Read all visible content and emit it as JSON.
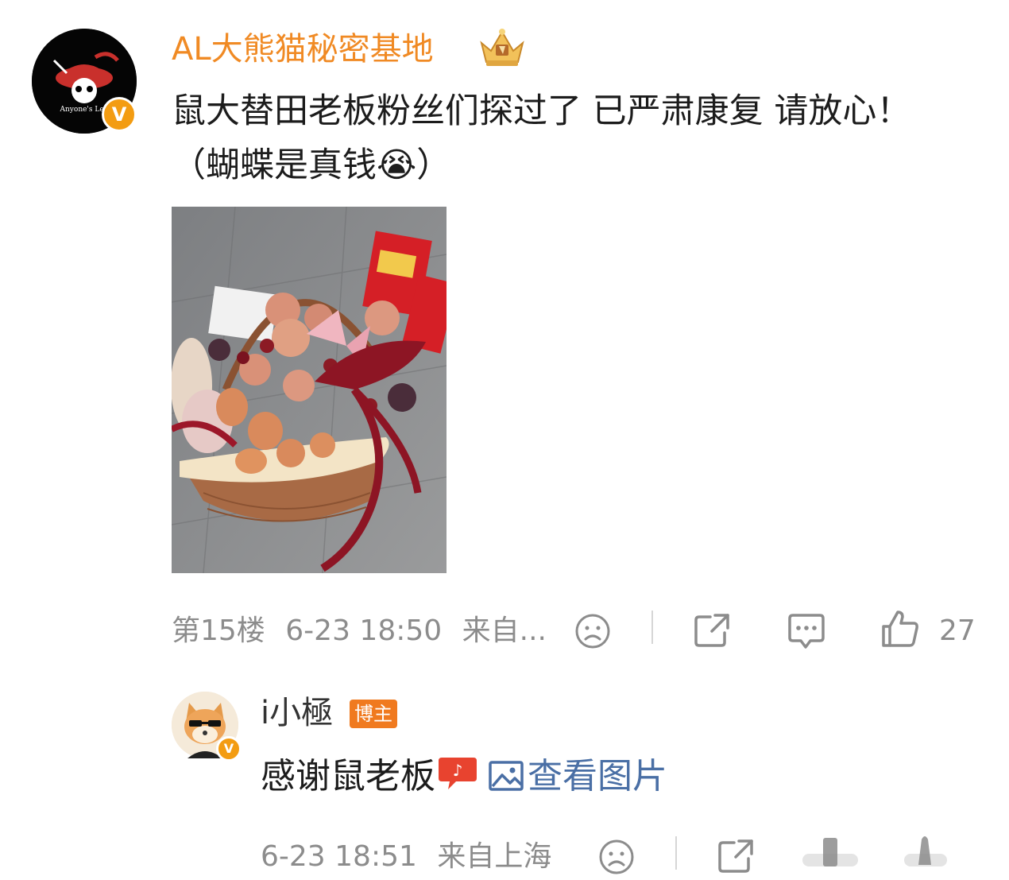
{
  "comment": {
    "username": "AL大熊猫秘密基地",
    "avatar_text": "Anyone's Leg",
    "verified_badge": "V",
    "text": "鼠大替田老板粉丝们探过了 已严肃康复 请放心！（蝴蝶是真钱😭）",
    "floor": "第15楼",
    "time": "6-23 18:50",
    "source": "来自...",
    "likes": "27"
  },
  "reply": {
    "username": "i小極",
    "author_badge": "博主",
    "verified_badge": "V",
    "text": "感谢鼠老板",
    "view_image_label": "查看图片",
    "time": "6-23 18:51",
    "source": "来自上海"
  },
  "colors": {
    "username_orange": "#f08a24",
    "meta_gray": "#8c8c8c",
    "link_blue": "#4a6fa5",
    "badge_orange": "#f07a1f"
  },
  "icons": [
    "crown-icon",
    "sad-face-icon",
    "share-icon",
    "comment-icon",
    "thumb-up-icon",
    "sticker-icon",
    "image-icon"
  ]
}
